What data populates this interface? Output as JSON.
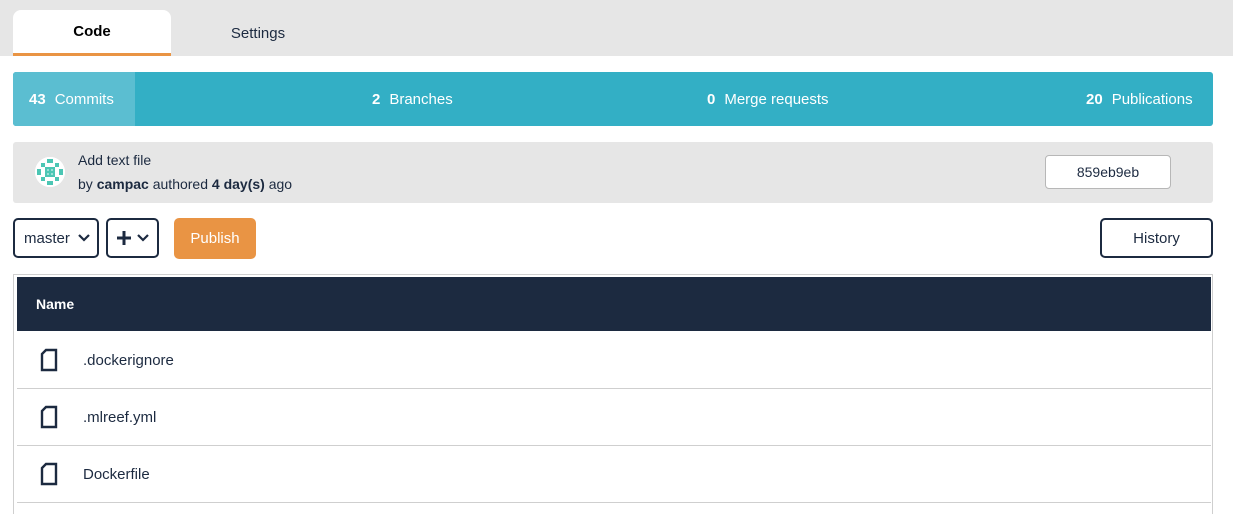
{
  "tabs": {
    "code": "Code",
    "settings": "Settings"
  },
  "stats": {
    "commits": {
      "count": "43",
      "label": "Commits"
    },
    "branches": {
      "count": "2",
      "label": "Branches"
    },
    "merge_requests": {
      "count": "0",
      "label": "Merge requests"
    },
    "publications": {
      "count": "20",
      "label": "Publications"
    }
  },
  "last_commit": {
    "message": "Add text file",
    "by": "by",
    "author": "campac",
    "authored": "authored",
    "age": "4 day(s)",
    "ago": "ago",
    "sha": "859eb9eb"
  },
  "toolbar": {
    "branch": "master",
    "add_icon": "plus-icon",
    "publish_label": "Publish",
    "history_label": "History"
  },
  "files": {
    "header": "Name",
    "rows": [
      {
        "name": ".dockerignore",
        "icon": "file-icon"
      },
      {
        "name": ".mlreef.yml",
        "icon": "file-icon"
      },
      {
        "name": "Dockerfile",
        "icon": "file-icon"
      }
    ]
  },
  "colors": {
    "accent_teal": "#33afc5",
    "accent_orange": "#e99444",
    "navy": "#1c2a40"
  }
}
